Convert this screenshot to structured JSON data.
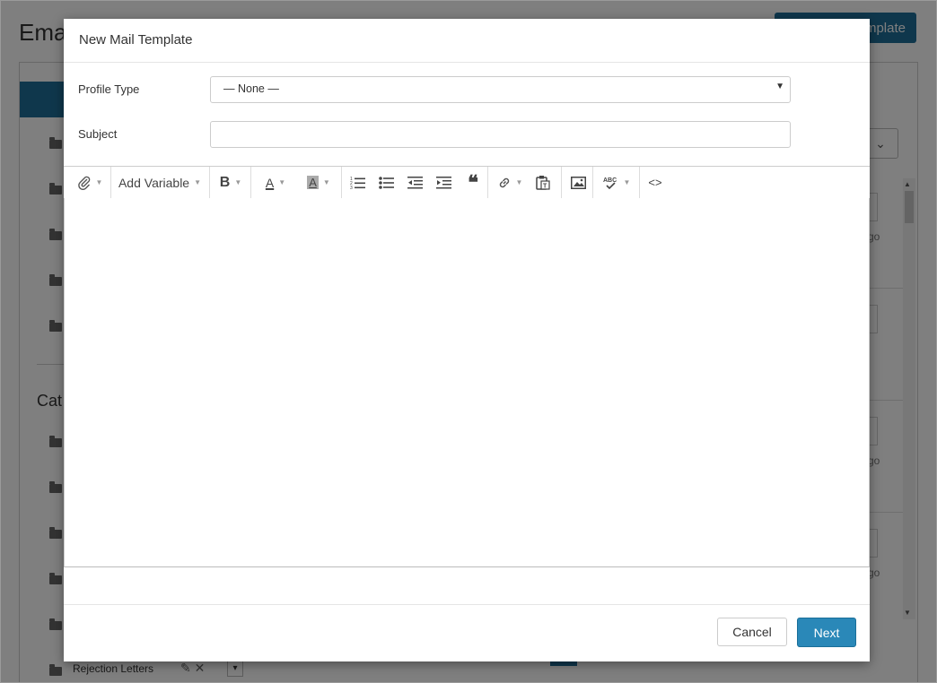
{
  "background": {
    "page_title": "Ema",
    "create_button_label": "mplate",
    "categories_heading": "Cat",
    "folder_item_label": "Rejection Letters",
    "row_text": "go",
    "select_caret": "⌄"
  },
  "modal": {
    "title": "New Mail Template",
    "profile_type_label": "Profile Type",
    "profile_type_value": "— None —",
    "subject_label": "Subject",
    "subject_value": "",
    "toolbar": {
      "add_variable_label": "Add Variable",
      "bold": "B",
      "text_color": "A",
      "bg_color": "A",
      "quote": "❝",
      "source": "<>"
    },
    "cancel_label": "Cancel",
    "next_label": "Next"
  },
  "colors": {
    "primary": "#2a88b8",
    "dark_primary": "#1f6f99",
    "overlay": "rgba(0,0,0,0.5)"
  }
}
